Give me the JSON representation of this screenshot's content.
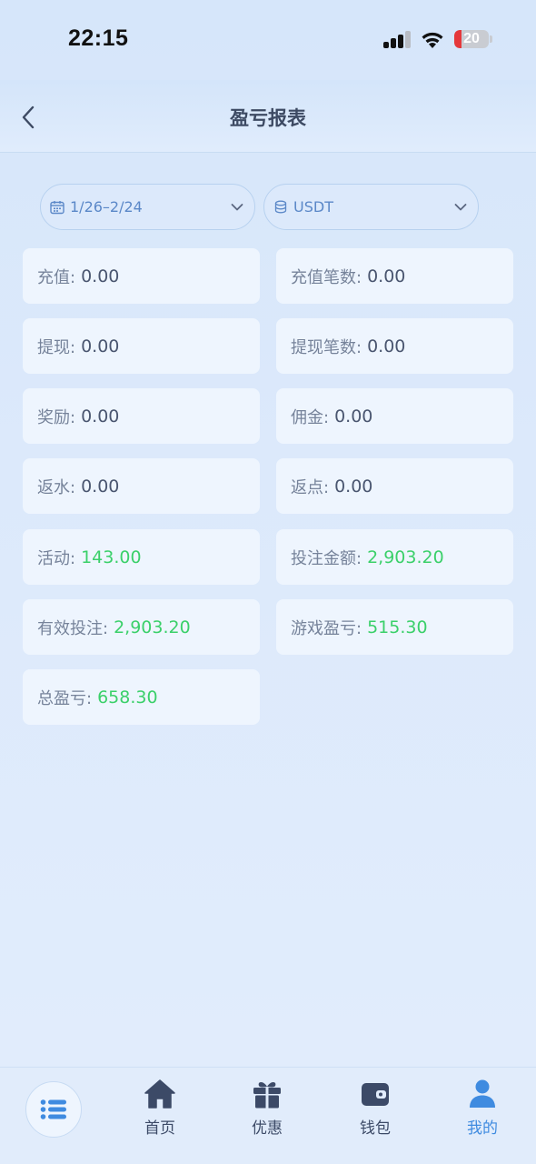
{
  "status_bar": {
    "time": "22:15",
    "battery": "20"
  },
  "header": {
    "title": "盈亏报表"
  },
  "filters": {
    "date_range": "1/26–2/24",
    "currency": "USDT"
  },
  "stats": [
    {
      "label": "充值:",
      "value": "0.00",
      "highlight": false
    },
    {
      "label": "充值笔数:",
      "value": "0.00",
      "highlight": false
    },
    {
      "label": "提现:",
      "value": "0.00",
      "highlight": false
    },
    {
      "label": "提现笔数:",
      "value": "0.00",
      "highlight": false
    },
    {
      "label": "奖励:",
      "value": "0.00",
      "highlight": false
    },
    {
      "label": "佣金:",
      "value": "0.00",
      "highlight": false
    },
    {
      "label": "返水:",
      "value": "0.00",
      "highlight": false
    },
    {
      "label": "返点:",
      "value": "0.00",
      "highlight": false
    },
    {
      "label": "活动:",
      "value": "143.00",
      "highlight": true
    },
    {
      "label": "投注金额:",
      "value": "2,903.20",
      "highlight": true
    },
    {
      "label": "有效投注:",
      "value": "2,903.20",
      "highlight": true
    },
    {
      "label": "游戏盈亏:",
      "value": "515.30",
      "highlight": true
    },
    {
      "label": "总盈亏:",
      "value": "658.30",
      "highlight": true
    }
  ],
  "nav": {
    "items": [
      {
        "label": "首页",
        "icon": "home-icon"
      },
      {
        "label": "优惠",
        "icon": "gift-icon"
      },
      {
        "label": "钱包",
        "icon": "wallet-icon"
      },
      {
        "label": "我的",
        "icon": "user-icon",
        "active": true
      }
    ]
  },
  "colors": {
    "accent": "#3f8be0",
    "positive": "#3bd06a",
    "battery_low": "#e5383b"
  }
}
